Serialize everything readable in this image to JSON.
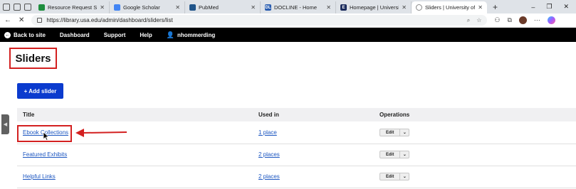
{
  "browser": {
    "tabs": [
      {
        "title": "Resource Request Spreadsh",
        "favicon_color": "#1e8e3e"
      },
      {
        "title": "Google Scholar",
        "favicon_color": "#4285f4"
      },
      {
        "title": "PubMed",
        "favicon_color": "#20558a"
      },
      {
        "title": "DOCLINE - Home",
        "favicon_color": "#2a5db0",
        "favicon_text": "DL"
      },
      {
        "title": "Homepage | University of",
        "favicon_color": "#1a2b5c",
        "favicon_text": "E"
      },
      {
        "title": "Sliders | University of St. A",
        "favicon_color": "#888888",
        "active": true
      }
    ],
    "new_tab": "+",
    "window_controls": [
      "–",
      "❐",
      "✕"
    ],
    "url": "https://library.usa.edu/admin/dashboard/sliders/list"
  },
  "admin_toolbar": {
    "back": "Back to site",
    "dashboard": "Dashboard",
    "support": "Support",
    "help": "Help",
    "user": "nhommerding"
  },
  "page": {
    "title": "Sliders",
    "add_button": "+ Add slider"
  },
  "table": {
    "headers": {
      "title": "Title",
      "used_in": "Used in",
      "operations": "Operations"
    },
    "rows": [
      {
        "title": "Ebook Collections",
        "used_in": "1 place",
        "operation": "Edit"
      },
      {
        "title": "Featured Exhibits",
        "used_in": "2 places",
        "operation": "Edit"
      },
      {
        "title": "Helpful Links",
        "used_in": "2 places",
        "operation": "Edit"
      }
    ]
  },
  "annotation_color": "#d32020"
}
